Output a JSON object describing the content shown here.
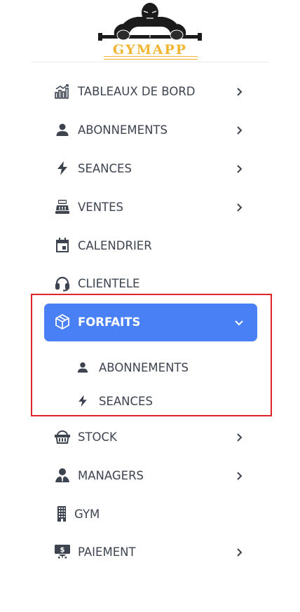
{
  "logo": {
    "text": "GYMAPP",
    "icon": "bodybuilder-logo"
  },
  "menu": [
    {
      "label": "TABLEAUX DE BORD",
      "icon": "chart-icon",
      "has_chevron": true
    },
    {
      "label": "ABONNEMENTS",
      "icon": "user-icon",
      "has_chevron": true
    },
    {
      "label": "SEANCES",
      "icon": "bolt-icon",
      "has_chevron": true
    },
    {
      "label": "VENTES",
      "icon": "cash-register-icon",
      "has_chevron": true
    },
    {
      "label": "CALENDRIER",
      "icon": "calendar-icon",
      "has_chevron": false
    },
    {
      "label": "CLIENTELE",
      "icon": "headset-icon",
      "has_chevron": false
    },
    {
      "label": "FORFAITS",
      "icon": "package-icon",
      "has_chevron": true,
      "active": true,
      "expanded": true
    },
    {
      "label": "STOCK",
      "icon": "basket-icon",
      "has_chevron": true
    },
    {
      "label": "MANAGERS",
      "icon": "manager-icon",
      "has_chevron": true
    },
    {
      "label": "GYM",
      "icon": "building-icon",
      "has_chevron": false
    },
    {
      "label": "PAIEMENT",
      "icon": "payment-icon",
      "has_chevron": true
    }
  ],
  "submenu": [
    {
      "label": "ABONNEMENTS",
      "icon": "user-icon"
    },
    {
      "label": "SEANCES",
      "icon": "bolt-icon"
    }
  ],
  "colors": {
    "accent": "#4a80f5",
    "text": "#3d4450",
    "highlight": "#e0232b",
    "logo": "#f2b532"
  }
}
